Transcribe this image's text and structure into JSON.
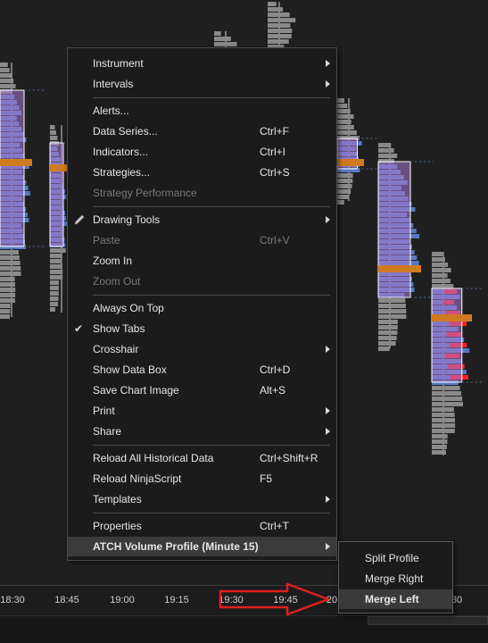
{
  "time_axis": {
    "ticks": [
      "18:30",
      "18:45",
      "19:00",
      "19:15",
      "19:30",
      "19:45",
      "20",
      "30"
    ]
  },
  "context_menu": {
    "items": [
      {
        "label": "Instrument",
        "shortcut": "",
        "submenu": true,
        "disabled": false
      },
      {
        "label": "Intervals",
        "shortcut": "",
        "submenu": true,
        "disabled": false
      },
      {
        "label": "Alerts...",
        "shortcut": "",
        "submenu": false,
        "disabled": false
      },
      {
        "label": "Data Series...",
        "shortcut": "Ctrl+F",
        "submenu": false,
        "disabled": false
      },
      {
        "label": "Indicators...",
        "shortcut": "Ctrl+I",
        "submenu": false,
        "disabled": false
      },
      {
        "label": "Strategies...",
        "shortcut": "Ctrl+S",
        "submenu": false,
        "disabled": false
      },
      {
        "label": "Strategy Performance",
        "shortcut": "",
        "submenu": false,
        "disabled": true
      },
      {
        "label": "Drawing Tools",
        "shortcut": "",
        "submenu": true,
        "disabled": false,
        "icon": "pencil-icon"
      },
      {
        "label": "Paste",
        "shortcut": "Ctrl+V",
        "submenu": false,
        "disabled": true
      },
      {
        "label": "Zoom In",
        "shortcut": "",
        "submenu": false,
        "disabled": false
      },
      {
        "label": "Zoom Out",
        "shortcut": "",
        "submenu": false,
        "disabled": true
      },
      {
        "label": "Always On Top",
        "shortcut": "",
        "submenu": false,
        "disabled": false
      },
      {
        "label": "Show Tabs",
        "shortcut": "",
        "submenu": false,
        "disabled": false,
        "checked": true
      },
      {
        "label": "Crosshair",
        "shortcut": "",
        "submenu": true,
        "disabled": false
      },
      {
        "label": "Show Data Box",
        "shortcut": "Ctrl+D",
        "submenu": false,
        "disabled": false
      },
      {
        "label": "Save Chart Image",
        "shortcut": "Alt+S",
        "submenu": false,
        "disabled": false
      },
      {
        "label": "Print",
        "shortcut": "",
        "submenu": true,
        "disabled": false
      },
      {
        "label": "Share",
        "shortcut": "",
        "submenu": true,
        "disabled": false
      },
      {
        "label": "Reload All Historical Data",
        "shortcut": "Ctrl+Shift+R",
        "submenu": false,
        "disabled": false
      },
      {
        "label": "Reload NinjaScript",
        "shortcut": "F5",
        "submenu": false,
        "disabled": false
      },
      {
        "label": "Templates",
        "shortcut": "",
        "submenu": true,
        "disabled": false
      },
      {
        "label": "Properties",
        "shortcut": "Ctrl+T",
        "submenu": false,
        "disabled": false
      },
      {
        "label": "ATCH Volume Profile (Minute 15)",
        "shortcut": "",
        "submenu": true,
        "disabled": false,
        "highlighted": true
      }
    ]
  },
  "submenu": {
    "items": [
      {
        "label": "Split Profile",
        "hover": false
      },
      {
        "label": "Merge Right",
        "hover": false
      },
      {
        "label": "Merge Left",
        "hover": true
      }
    ]
  },
  "colors": {
    "background": "#1f1f1f",
    "menu_background": "#1b1b1b",
    "profile_red": "#ff2020",
    "profile_blue": "#5a78c0",
    "profile_gray": "#8a8a8a",
    "value_area_overlay": "#a878d0",
    "poc_orange": "#d07a20",
    "annotation_arrow": "#e02020"
  }
}
